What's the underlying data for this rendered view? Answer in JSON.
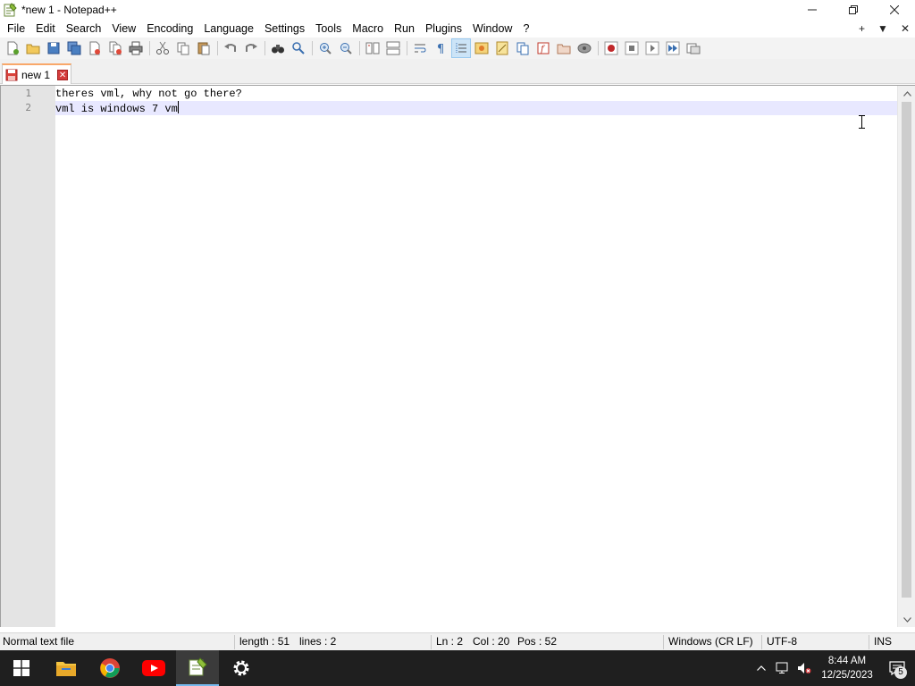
{
  "window": {
    "title": "*new 1 - Notepad++",
    "minimize_glyph": "—",
    "restore_glyph": "❐",
    "close_glyph": "✕"
  },
  "menu": {
    "items": [
      {
        "label": "File"
      },
      {
        "label": "Edit"
      },
      {
        "label": "Search"
      },
      {
        "label": "View"
      },
      {
        "label": "Encoding"
      },
      {
        "label": "Language"
      },
      {
        "label": "Settings"
      },
      {
        "label": "Tools"
      },
      {
        "label": "Macro"
      },
      {
        "label": "Run"
      },
      {
        "label": "Plugins"
      },
      {
        "label": "Window"
      },
      {
        "label": "?"
      }
    ],
    "right": {
      "add_glyph": "+",
      "dropdown_glyph": "▼",
      "close_glyph": "✕"
    }
  },
  "tabs": [
    {
      "label": "new 1",
      "close_glyph": "✕"
    }
  ],
  "editor": {
    "lines": [
      {
        "number": "1",
        "text": "theres vml, why not go there?"
      },
      {
        "number": "2",
        "text": "vml is windows 7 vm"
      }
    ]
  },
  "status": {
    "file_type": "Normal text file",
    "length": "length : 51",
    "lines": "lines : 2",
    "ln": "Ln : 2",
    "col": "Col : 20",
    "pos": "Pos : 52",
    "eol": "Windows (CR LF)",
    "encoding": "UTF-8",
    "mode": "INS"
  },
  "taskbar": {
    "time": "8:44 AM",
    "date": "12/25/2023",
    "notification_count": "5"
  },
  "colors": {
    "accent_tab": "#f9a86a",
    "current_line": "#e8e8ff",
    "taskbar": "#1f1f1f"
  }
}
